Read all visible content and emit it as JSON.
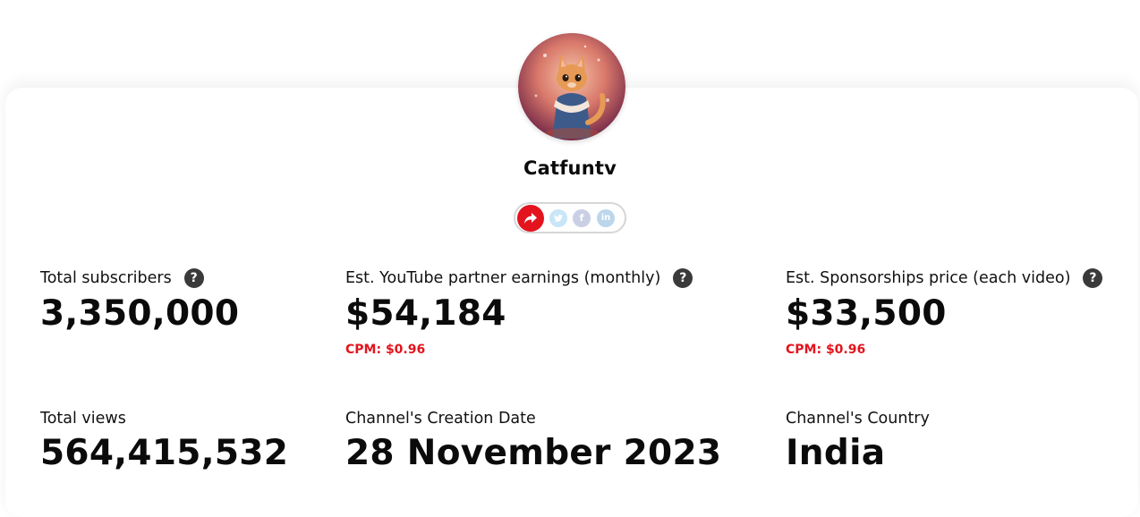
{
  "channel": {
    "name": "Catfuntv"
  },
  "share": {
    "share_icon": "share-arrow-icon",
    "twitter_icon": "twitter-icon",
    "facebook_letter": "f",
    "linkedin_letter": "in"
  },
  "stats": {
    "subscribers": {
      "label": "Total subscribers",
      "value": "3,350,000"
    },
    "earnings": {
      "label": "Est. YouTube partner earnings (monthly)",
      "value": "$54,184",
      "cpm": "CPM: $0.96"
    },
    "sponsorship": {
      "label": "Est. Sponsorships price (each video)",
      "value": "$33,500",
      "cpm": "CPM: $0.96"
    },
    "views": {
      "label": "Total views",
      "value": "564,415,532"
    },
    "creation_date": {
      "label": "Channel's Creation Date",
      "value": "28 November 2023"
    },
    "country": {
      "label": "Channel's Country",
      "value": "India"
    }
  },
  "help_symbol": "?",
  "colors": {
    "accent_red": "#e3141d",
    "help_bg": "#3a3a3a"
  }
}
